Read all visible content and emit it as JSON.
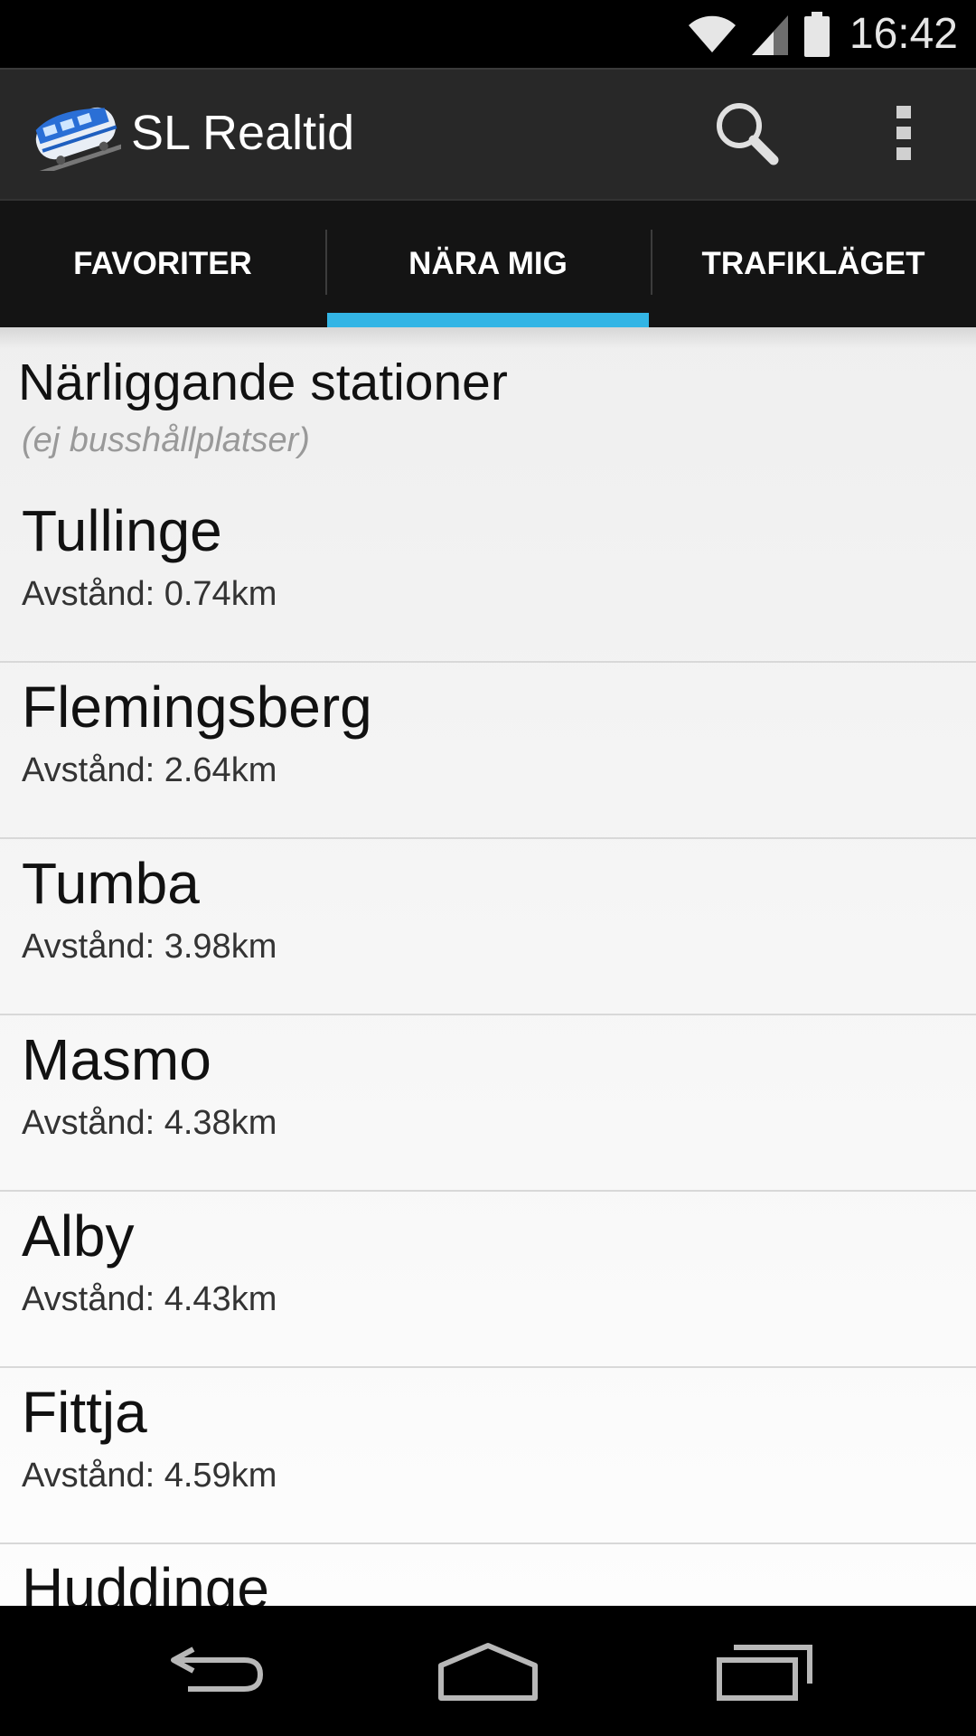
{
  "status_bar": {
    "time": "16:42",
    "icons": [
      "wifi-icon",
      "signal-icon",
      "battery-icon"
    ]
  },
  "action_bar": {
    "title": "SL Realtid",
    "logo_icon": "train-icon",
    "actions": [
      "search-icon",
      "overflow-menu-icon"
    ]
  },
  "tabs": [
    {
      "label": "FAVORITER",
      "active": false
    },
    {
      "label": "NÄRA MIG",
      "active": true
    },
    {
      "label": "TRAFIKLÄGET",
      "active": false
    }
  ],
  "section": {
    "title": "Närliggande stationer",
    "subtitle": "(ej busshållplatser)"
  },
  "stations": [
    {
      "name": "Tullinge",
      "distance": "Avstånd: 0.74km"
    },
    {
      "name": "Flemingsberg",
      "distance": "Avstånd: 2.64km"
    },
    {
      "name": "Tumba",
      "distance": "Avstånd: 3.98km"
    },
    {
      "name": "Masmo",
      "distance": "Avstånd: 4.38km"
    },
    {
      "name": "Alby",
      "distance": "Avstånd: 4.43km"
    },
    {
      "name": "Fittja",
      "distance": "Avstånd: 4.59km"
    },
    {
      "name": "Huddinge",
      "distance": ""
    }
  ],
  "nav_bar": [
    "back-icon",
    "home-icon",
    "recents-icon"
  ],
  "colors": {
    "accent": "#33b5e5",
    "action_bar": "#282828",
    "tab_bar": "#141414"
  }
}
